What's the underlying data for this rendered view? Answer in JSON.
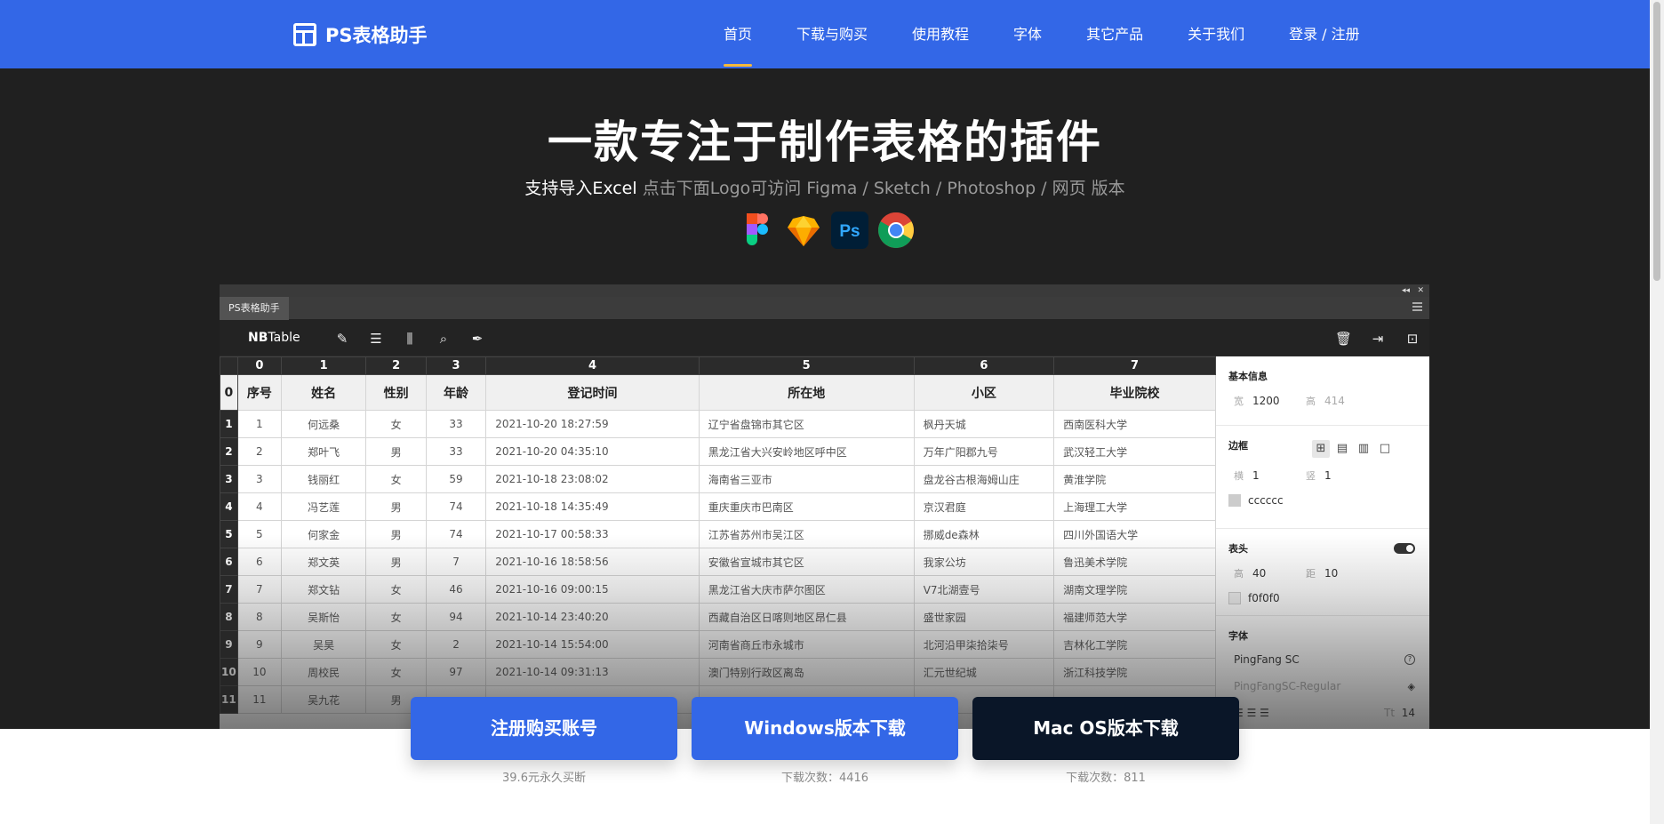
{
  "nav": {
    "brand": "PS表格助手",
    "items": [
      "首页",
      "下载与购买",
      "使用教程",
      "字体",
      "其它产品",
      "关于我们",
      "登录 / 注册"
    ],
    "active_index": 0
  },
  "hero": {
    "title": "一款专注于制作表格的插件",
    "subtitle_highlight": "支持导入Excel",
    "subtitle_rest": "点击下面Logo可访问 Figma / Sketch / Photoshop / 网页 版本",
    "logos": [
      "figma-icon",
      "sketch-icon",
      "photoshop-icon",
      "chrome-icon"
    ]
  },
  "plugin": {
    "tab_label": "PS表格助手",
    "brand_bold": "NB",
    "brand_rest": "Table",
    "toolbar_icons": [
      "pencil-icon",
      "add-row-icon",
      "add-column-icon",
      "search-icon",
      "feather-icon"
    ],
    "right_icons": [
      "trash-icon",
      "export-icon",
      "robot-icon"
    ],
    "col_index": [
      "0",
      "1",
      "2",
      "3",
      "4",
      "5",
      "6",
      "7"
    ],
    "headers": [
      "序号",
      "姓名",
      "性别",
      "年龄",
      "登记时间",
      "所在地",
      "小区",
      "毕业院校"
    ],
    "rows": [
      [
        "1",
        "1",
        "何远桑",
        "女",
        "33",
        "2021-10-20 18:27:59",
        "辽宁省盘锦市其它区",
        "枫丹天城",
        "西南医科大学"
      ],
      [
        "2",
        "2",
        "郑叶飞",
        "男",
        "33",
        "2021-10-20 04:35:10",
        "黑龙江省大兴安岭地区呼中区",
        "万年广阳郡九号",
        "武汉轻工大学"
      ],
      [
        "3",
        "3",
        "钱丽红",
        "女",
        "59",
        "2021-10-18 23:08:02",
        "海南省三亚市",
        "盘龙谷古根海姆山庄",
        "黄淮学院"
      ],
      [
        "4",
        "4",
        "冯艺莲",
        "男",
        "74",
        "2021-10-18 14:35:49",
        "重庆重庆市巴南区",
        "京汉君庭",
        "上海理工大学"
      ],
      [
        "5",
        "5",
        "何家金",
        "男",
        "74",
        "2021-10-17 00:58:33",
        "江苏省苏州市吴江区",
        "挪威de森林",
        "四川外国语大学"
      ],
      [
        "6",
        "6",
        "郑文英",
        "男",
        "7",
        "2021-10-16 18:58:56",
        "安徽省宣城市其它区",
        "我家公坊",
        "鲁迅美术学院"
      ],
      [
        "7",
        "7",
        "郑文钻",
        "女",
        "46",
        "2021-10-16 09:00:15",
        "黑龙江省大庆市萨尔图区",
        "V7北湖壹号",
        "湖南文理学院"
      ],
      [
        "8",
        "8",
        "吴斯怡",
        "女",
        "94",
        "2021-10-14 23:40:20",
        "西藏自治区日喀则地区昂仁县",
        "盛世家园",
        "福建师范大学"
      ],
      [
        "9",
        "9",
        "吴昊",
        "女",
        "2",
        "2021-10-14 15:54:00",
        "河南省商丘市永城市",
        "北河沿甲柒拾柒号",
        "吉林化工学院"
      ],
      [
        "10",
        "10",
        "周校民",
        "女",
        "97",
        "2021-10-14 09:31:13",
        "澳门特别行政区离岛",
        "汇元世纪城",
        "浙江科技学院"
      ],
      [
        "11",
        "11",
        "吴九花",
        "男",
        "",
        "",
        "",
        "",
        ""
      ]
    ],
    "panel": {
      "basic_title": "基本信息",
      "width_label": "宽",
      "width_value": "1200",
      "height_label": "高",
      "height_value": "414",
      "border_title": "边框",
      "border_icons": [
        "grid-all-icon",
        "grid-rows-icon",
        "grid-cols-icon",
        "grid-outer-icon"
      ],
      "bh_label": "横",
      "bh_value": "1",
      "bv_label": "竖",
      "bv_value": "1",
      "border_color": "cccccc",
      "header_title": "表头",
      "hh_label": "高",
      "hh_value": "40",
      "hd_label": "距",
      "hd_value": "10",
      "header_color": "f0f0f0",
      "font_title": "字体",
      "font_family": "PingFang SC",
      "font_style": "PingFangSC-Regular",
      "font_size_label": "Tt",
      "font_size": "14"
    }
  },
  "buttons": [
    {
      "label": "注册购买账号",
      "sub": "39.6元永久买断",
      "style": "blue"
    },
    {
      "label": "Windows版本下载",
      "sub": "下载次数：4416",
      "style": "blue"
    },
    {
      "label": "Mac OS版本下载",
      "sub": "下载次数：811",
      "style": "dark"
    }
  ],
  "colors": {
    "brand_blue": "#3367e7",
    "dark_button": "#0a1628",
    "hero_bg": "#202020",
    "nav_underline": "#f5b93b"
  }
}
